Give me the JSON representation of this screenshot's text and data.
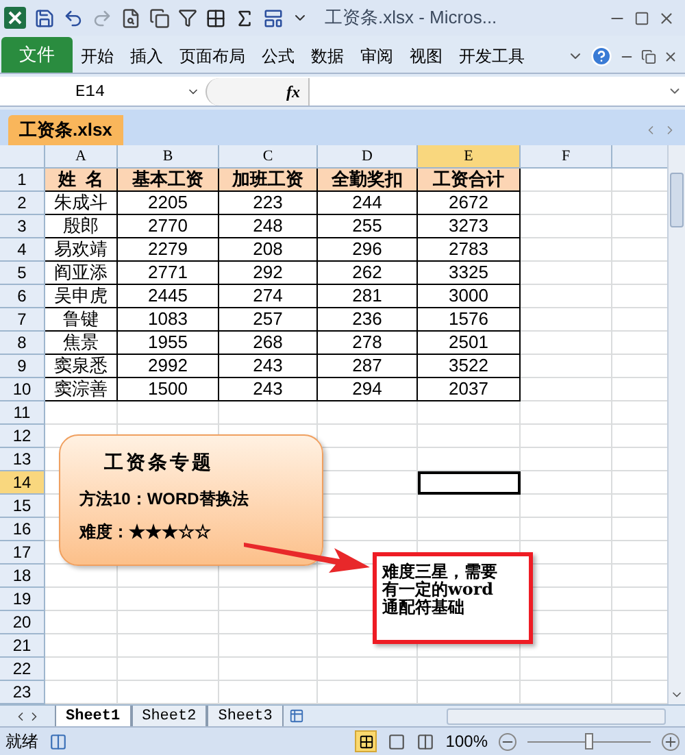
{
  "title_bar": {
    "title": "工资条.xlsx - Micros..."
  },
  "ribbon_tabs": [
    {
      "label": "文件",
      "kind": "file",
      "selected": false
    },
    {
      "label": "开始",
      "kind": "tab",
      "selected": false
    },
    {
      "label": "插入",
      "kind": "tab",
      "selected": false
    },
    {
      "label": "页面布局",
      "kind": "tab",
      "selected": false
    },
    {
      "label": "公式",
      "kind": "tab",
      "selected": false
    },
    {
      "label": "数据",
      "kind": "tab",
      "selected": false
    },
    {
      "label": "审阅",
      "kind": "tab",
      "selected": false
    },
    {
      "label": "视图",
      "kind": "tab",
      "selected": false
    },
    {
      "label": "开发工具",
      "kind": "tab",
      "selected": false
    }
  ],
  "formula_bar": {
    "name_box": "E14",
    "fx": "fx"
  },
  "workbook_tab": {
    "label": "工资条.xlsx"
  },
  "column_headers": [
    {
      "label": "A",
      "selected": false
    },
    {
      "label": "B",
      "selected": false
    },
    {
      "label": "C",
      "selected": false
    },
    {
      "label": "D",
      "selected": false
    },
    {
      "label": "E",
      "selected": true
    },
    {
      "label": "F",
      "selected": false
    }
  ],
  "row_headers": [
    {
      "label": "1",
      "selected": false
    },
    {
      "label": "2",
      "selected": false
    },
    {
      "label": "3",
      "selected": false
    },
    {
      "label": "4",
      "selected": false
    },
    {
      "label": "5",
      "selected": false
    },
    {
      "label": "6",
      "selected": false
    },
    {
      "label": "7",
      "selected": false
    },
    {
      "label": "8",
      "selected": false
    },
    {
      "label": "9",
      "selected": false
    },
    {
      "label": "10",
      "selected": false
    },
    {
      "label": "11",
      "selected": false
    },
    {
      "label": "12",
      "selected": false
    },
    {
      "label": "13",
      "selected": false
    },
    {
      "label": "14",
      "selected": true
    },
    {
      "label": "15",
      "selected": false
    },
    {
      "label": "16",
      "selected": false
    },
    {
      "label": "17",
      "selected": false
    },
    {
      "label": "18",
      "selected": false
    },
    {
      "label": "19",
      "selected": false
    },
    {
      "label": "20",
      "selected": false
    },
    {
      "label": "21",
      "selected": false
    },
    {
      "label": "22",
      "selected": false
    },
    {
      "label": "23",
      "selected": false
    }
  ],
  "table": {
    "columns": [
      "姓  名",
      "基本工资",
      "加班工资",
      "全勤奖扣",
      "工资合计"
    ],
    "rows": [
      [
        "朱成斗",
        "2205",
        "223",
        "244",
        "2672"
      ],
      [
        "殷郎",
        "2770",
        "248",
        "255",
        "3273"
      ],
      [
        "易欢靖",
        "2279",
        "208",
        "296",
        "2783"
      ],
      [
        "阎亚添",
        "2771",
        "292",
        "262",
        "3325"
      ],
      [
        "吴申虎",
        "2445",
        "274",
        "281",
        "3000"
      ],
      [
        "鲁键",
        "1083",
        "257",
        "236",
        "1576"
      ],
      [
        "焦景",
        "1955",
        "268",
        "278",
        "2501"
      ],
      [
        "窦泉悉",
        "2992",
        "243",
        "287",
        "3522"
      ],
      [
        "窦淙善",
        "1500",
        "243",
        "294",
        "2037"
      ]
    ]
  },
  "callout": {
    "title": "工资条专题",
    "lines": [
      "方法10：WORD替换法",
      "难度：★★★☆☆"
    ]
  },
  "text_box": {
    "lines": [
      "难度三星，需要",
      "有一定的word",
      "通配符基础"
    ]
  },
  "sheet_tabs": [
    {
      "label": "Sheet1",
      "selected": true
    },
    {
      "label": "Sheet2",
      "selected": false
    },
    {
      "label": "Sheet3",
      "selected": false
    }
  ],
  "status_bar": {
    "status": "就绪",
    "zoom": "100%",
    "zoom_level": {
      "level": 0.5
    }
  }
}
